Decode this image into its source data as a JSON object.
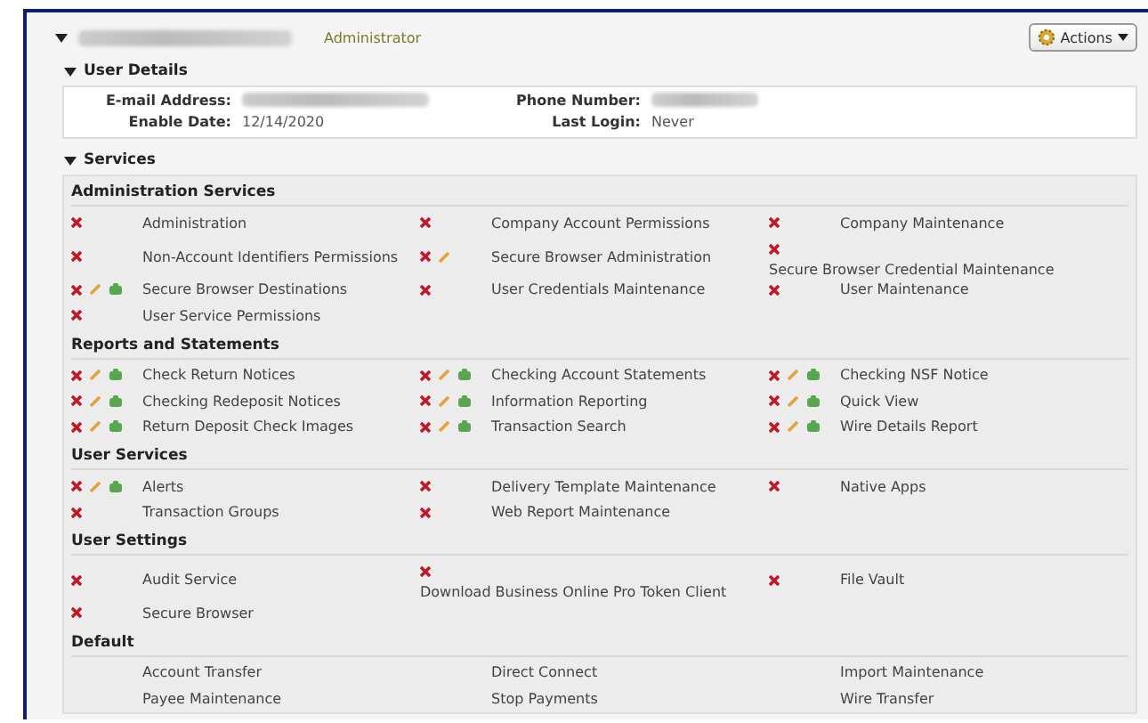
{
  "header": {
    "name_redacted": true,
    "role": "Administrator",
    "actions_button": "Actions"
  },
  "user_details": {
    "title": "User Details",
    "fields": [
      {
        "label": "E-mail Address:",
        "redacted": true
      },
      {
        "label": "Phone Number:",
        "redacted": true
      },
      {
        "label": "Enable Date:",
        "redacted": false,
        "value": "12/14/2020"
      },
      {
        "label": "Last Login:",
        "redacted": false,
        "value": "Never"
      }
    ]
  },
  "services": {
    "title": "Services",
    "groups": [
      {
        "title": "Administration Services",
        "items": [
          {
            "name": "Administration",
            "deny": true,
            "edit": false,
            "view": false
          },
          {
            "name": "Company Account Permissions",
            "deny": true,
            "edit": false,
            "view": false
          },
          {
            "name": "Company Maintenance",
            "deny": true,
            "edit": false,
            "view": false
          },
          {
            "name": "Non-Account Identifiers Permissions",
            "deny": true,
            "edit": false,
            "view": false
          },
          {
            "name": "Secure Browser Administration",
            "deny": true,
            "edit": true,
            "view": false
          },
          {
            "name": "Secure Browser Credential Maintenance",
            "deny": true,
            "edit": false,
            "view": false
          },
          {
            "name": "Secure Browser Destinations",
            "deny": true,
            "edit": true,
            "view": true
          },
          {
            "name": "User Credentials Maintenance",
            "deny": true,
            "edit": false,
            "view": false
          },
          {
            "name": "User Maintenance",
            "deny": true,
            "edit": false,
            "view": false
          },
          {
            "name": "User Service Permissions",
            "deny": true,
            "edit": false,
            "view": false
          }
        ]
      },
      {
        "title": "Reports and Statements",
        "items": [
          {
            "name": "Check Return Notices",
            "deny": true,
            "edit": true,
            "view": true
          },
          {
            "name": "Checking Account Statements",
            "deny": true,
            "edit": true,
            "view": true
          },
          {
            "name": "Checking NSF Notice",
            "deny": true,
            "edit": true,
            "view": true
          },
          {
            "name": "Checking Redeposit Notices",
            "deny": true,
            "edit": true,
            "view": true
          },
          {
            "name": "Information Reporting",
            "deny": true,
            "edit": true,
            "view": true
          },
          {
            "name": "Quick View",
            "deny": true,
            "edit": true,
            "view": true
          },
          {
            "name": "Return Deposit Check Images",
            "deny": true,
            "edit": true,
            "view": true
          },
          {
            "name": "Transaction Search",
            "deny": true,
            "edit": true,
            "view": true
          },
          {
            "name": "Wire Details Report",
            "deny": true,
            "edit": true,
            "view": true
          }
        ]
      },
      {
        "title": "User Services",
        "items": [
          {
            "name": "Alerts",
            "deny": true,
            "edit": true,
            "view": true
          },
          {
            "name": "Delivery Template Maintenance",
            "deny": true,
            "edit": false,
            "view": false
          },
          {
            "name": "Native Apps",
            "deny": true,
            "edit": false,
            "view": false
          },
          {
            "name": "Transaction Groups",
            "deny": true,
            "edit": false,
            "view": false
          },
          {
            "name": "Web Report Maintenance",
            "deny": true,
            "edit": false,
            "view": false
          }
        ]
      },
      {
        "title": "User Settings",
        "items": [
          {
            "name": "Audit Service",
            "deny": true,
            "edit": false,
            "view": false
          },
          {
            "name": "Download Business Online Pro Token Client",
            "deny": true,
            "edit": false,
            "view": false
          },
          {
            "name": "File Vault",
            "deny": true,
            "edit": false,
            "view": false
          },
          {
            "name": "Secure Browser",
            "deny": true,
            "edit": false,
            "view": false
          }
        ]
      },
      {
        "title": "Default",
        "items": [
          {
            "name": "Account Transfer",
            "deny": false,
            "edit": false,
            "view": false
          },
          {
            "name": "Direct Connect",
            "deny": false,
            "edit": false,
            "view": false
          },
          {
            "name": "Import Maintenance",
            "deny": false,
            "edit": false,
            "view": false
          },
          {
            "name": "Payee Maintenance",
            "deny": false,
            "edit": false,
            "view": false
          },
          {
            "name": "Stop Payments",
            "deny": false,
            "edit": false,
            "view": false
          },
          {
            "name": "Wire Transfer",
            "deny": false,
            "edit": false,
            "view": false
          }
        ]
      }
    ]
  }
}
